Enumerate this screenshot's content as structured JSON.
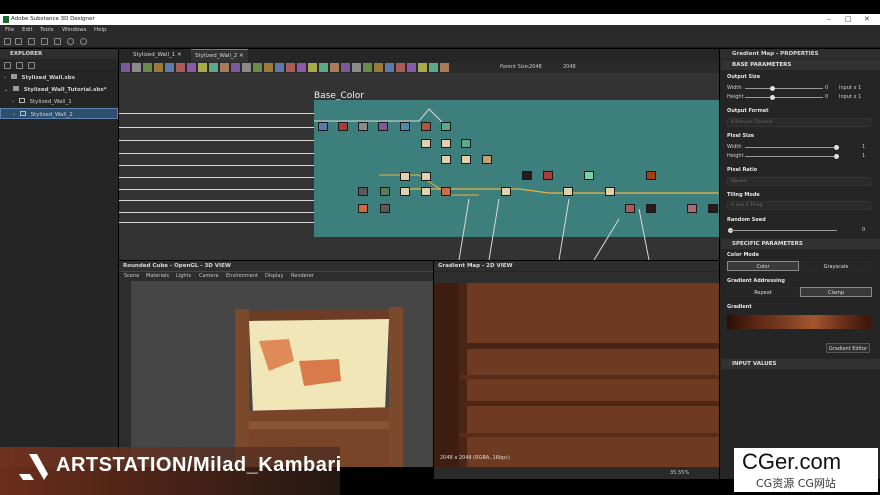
{
  "app": {
    "title": "Adobe Substance 3D Designer",
    "menu": [
      "File",
      "Edit",
      "Tools",
      "Windows",
      "Help"
    ]
  },
  "explorer": {
    "title": "EXPLORER",
    "items": [
      {
        "label": "Stylized_Wall.sbs",
        "level": 0
      },
      {
        "label": "Stylized_Wall_Tutorial.sbs*",
        "level": 0
      },
      {
        "label": "Stylized_Wall_1",
        "level": 1
      },
      {
        "label": "Stylized_Wall_2",
        "level": 1,
        "selected": true
      }
    ]
  },
  "graph": {
    "tabs": [
      {
        "label": "Stylized_Wall_1"
      },
      {
        "label": "Stylized_Wall_2",
        "active": true
      }
    ],
    "parent_size_label": "Parent Size:",
    "parent_size_value": "2048",
    "size_value": "2048",
    "frame_title": "Base_Color"
  },
  "view3d": {
    "title": "Rounded Cube - OpenGL - 3D VIEW",
    "menu": [
      "Scene",
      "Materials",
      "Lights",
      "Camera",
      "Environment",
      "Display",
      "Renderer"
    ]
  },
  "view2d": {
    "title": "Gradient Map - 2D VIEW",
    "status": "2048 x 2048 (RGBA, 16bpc)",
    "zoom": "35.55%"
  },
  "properties": {
    "title": "Gradient Map - PROPERTIES",
    "base_section": "BASE PARAMETERS",
    "output_size": {
      "label": "Output Size",
      "width_label": "Width",
      "height_label": "Height",
      "width_value": "0",
      "height_value": "0",
      "width_mode": "Input x 1",
      "height_mode": "Input x 1"
    },
    "output_format": {
      "label": "Output Format",
      "value": "8 Bits per Channel"
    },
    "pixel_size": {
      "label": "Pixel Size",
      "width_label": "Width",
      "height_label": "Height",
      "width_value": "1",
      "height_value": "1"
    },
    "pixel_ratio": {
      "label": "Pixel Ratio",
      "value": "Square"
    },
    "tiling_mode": {
      "label": "Tiling Mode",
      "value": "H and V Tiling"
    },
    "random_seed": {
      "label": "Random Seed",
      "value": "0"
    },
    "specific_section": "SPECIFIC PARAMETERS",
    "color_mode": {
      "label": "Color Mode",
      "options": [
        "Color",
        "Grayscale"
      ],
      "selected": "Color"
    },
    "gradient_addressing": {
      "label": "Gradient Addressing",
      "options": [
        "Repeat",
        "Clamp"
      ],
      "selected": "Clamp"
    },
    "gradient": {
      "label": "Gradient",
      "editor_button": "Gradient Editor"
    },
    "input_values_section": "INPUT VALUES"
  },
  "watermark": {
    "artstation": "ARTSTATION/Milad_Kambari",
    "cger_main": "CGer.com",
    "cger_sub": "CG资源 CG网站"
  },
  "colors": {
    "frame": "#3c7f7c",
    "accent": "#e8b547",
    "selection": "#2f4f6f"
  }
}
